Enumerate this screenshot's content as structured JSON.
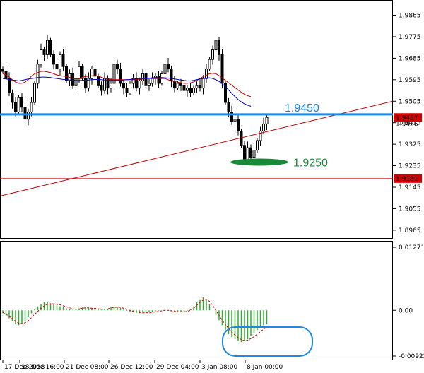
{
  "chart_data": [
    {
      "type": "candlestick",
      "panel": "price",
      "ylim": [
        1.8935,
        1.9905
      ],
      "yticks": [
        "1.9865",
        "1.9775",
        "1.9685",
        "1.9595",
        "1.9505",
        "1.9415",
        "1.9325",
        "1.9235",
        "1.9145",
        "1.9055",
        "1.8965"
      ],
      "xticks": [
        "17 Dec 2018",
        "18 Dec 16:00",
        "21 Dec 08:00",
        "26 Dec 12:00",
        "29 Dec 04:00",
        "3 Jan 08:00",
        "8 Jan 00:00"
      ],
      "current_price_label": "1.9437",
      "current_price_label_partial": "1.9426",
      "ma_fast_color": "#c00000",
      "ma_slow_color": "#0000c8",
      "candle_color": "#000000",
      "candles_close": [
        1.963,
        1.96,
        1.954,
        1.95,
        1.946,
        1.952,
        1.948,
        1.943,
        1.946,
        1.95,
        1.958,
        1.966,
        1.972,
        1.97,
        1.976,
        1.97,
        1.966,
        1.964,
        1.97,
        1.965,
        1.959,
        1.962,
        1.957,
        1.96,
        1.965,
        1.96,
        1.956,
        1.96,
        1.964,
        1.961,
        1.957,
        1.955,
        1.96,
        1.956,
        1.958,
        1.966,
        1.964,
        1.958,
        1.956,
        1.954,
        1.958,
        1.96,
        1.956,
        1.959,
        1.962,
        1.957,
        1.958,
        1.96,
        1.961,
        1.958,
        1.962,
        1.966,
        1.964,
        1.959,
        1.956,
        1.958,
        1.957,
        1.955,
        1.956,
        1.954,
        1.956,
        1.957,
        1.956,
        1.96,
        1.964,
        1.968,
        1.972,
        1.976,
        1.97,
        1.958,
        1.95,
        1.946,
        1.942,
        1.943,
        1.938,
        1.932,
        1.926,
        1.931,
        1.927,
        1.93,
        1.934,
        1.938,
        1.941,
        1.9437
      ],
      "ma_fast": [
        1.962,
        1.9615,
        1.9605,
        1.9595,
        1.9585,
        1.958,
        1.958,
        1.9585,
        1.9595,
        1.961,
        1.962,
        1.9625,
        1.963,
        1.963,
        1.9628,
        1.9625,
        1.962,
        1.9615,
        1.9612,
        1.961,
        1.9608,
        1.9605,
        1.96,
        1.9598,
        1.96,
        1.9605,
        1.9608,
        1.961,
        1.9612,
        1.9612,
        1.961,
        1.9605,
        1.96,
        1.9598,
        1.9595,
        1.9595,
        1.9595,
        1.9595,
        1.9595,
        1.9595,
        1.9595,
        1.9595,
        1.9595,
        1.9595,
        1.9598,
        1.96,
        1.96,
        1.96,
        1.96,
        1.96,
        1.96,
        1.96,
        1.9595,
        1.959,
        1.9588,
        1.9585,
        1.9582,
        1.958,
        1.958,
        1.9582,
        1.9586,
        1.9592,
        1.96,
        1.9608,
        1.9614,
        1.962,
        1.9622,
        1.962,
        1.9612,
        1.9602,
        1.9592,
        1.9582,
        1.9572,
        1.9562,
        1.9552,
        1.9542,
        1.9534,
        1.9528,
        1.9524
      ],
      "ma_slow": [
        1.96,
        1.9598,
        1.9596,
        1.9594,
        1.9592,
        1.959,
        1.9592,
        1.9595,
        1.9598,
        1.96,
        1.9602,
        1.9604,
        1.9606,
        1.9606,
        1.9605,
        1.9604,
        1.9602,
        1.96,
        1.9598,
        1.9596,
        1.9595,
        1.9594,
        1.9593,
        1.9592,
        1.9592,
        1.9592,
        1.9593,
        1.9594,
        1.9595,
        1.9596,
        1.9596,
        1.9595,
        1.9594,
        1.9593,
        1.9592,
        1.9592,
        1.9592,
        1.9593,
        1.9594,
        1.9595,
        1.9596,
        1.9597,
        1.9598,
        1.9599,
        1.96,
        1.9601,
        1.9602,
        1.9603,
        1.9604,
        1.9604,
        1.9604,
        1.9603,
        1.9602,
        1.96,
        1.9598,
        1.9596,
        1.9594,
        1.9592,
        1.959,
        1.959,
        1.9592,
        1.9595,
        1.9598,
        1.96,
        1.9602,
        1.9603,
        1.96,
        1.9595,
        1.9588,
        1.9578,
        1.9566,
        1.9552,
        1.9538,
        1.9524,
        1.9512,
        1.9502,
        1.9494,
        1.9488,
        1.9484
      ],
      "hlines": [
        {
          "value": 1.945,
          "label": "1.9450",
          "color": "#1e88e5"
        },
        {
          "value": 1.9181,
          "label": "1.9181",
          "color": "#d00000"
        }
      ],
      "trendline": {
        "from": [
          0,
          1.9108
        ],
        "to": [
          84,
          1.938
        ],
        "color": "#c00000"
      },
      "support_marker": {
        "value": 1.925,
        "label": "1.9250",
        "color": "#1a8a3a"
      }
    },
    {
      "type": "bar",
      "panel": "oscillator",
      "ylim": [
        -0.00922,
        0.01271
      ],
      "yticks": [
        "0.01271",
        "0.00",
        "-0.00922"
      ],
      "bar_color": "#33aa33",
      "signal_color": "#d00000",
      "values": [
        -0.0006,
        -0.001,
        -0.0016,
        -0.0022,
        -0.0028,
        -0.003,
        -0.0028,
        -0.0022,
        -0.0014,
        -0.0006,
        0.0002,
        0.0008,
        0.0012,
        0.0016,
        0.0016,
        0.0014,
        0.0012,
        0.001,
        0.0008,
        0.0006,
        0.0004,
        0.0002,
        0.0001,
        0.0002,
        0.0004,
        0.0006,
        0.0005,
        0.0004,
        0.0004,
        0.0003,
        0.0002,
        0.0001,
        0.0002,
        0.0003,
        0.0006,
        0.0008,
        0.0007,
        0.0005,
        0.0002,
        -0.0001,
        -0.0003,
        -0.0004,
        -0.0005,
        -0.0006,
        -0.0006,
        -0.0005,
        -0.0004,
        -0.0003,
        -0.0002,
        -0.0001,
        0.0,
        0.0001,
        0.0,
        -0.0002,
        -0.0003,
        -0.0004,
        -0.0003,
        -0.0002,
        -0.0001,
        0.0002,
        0.0008,
        0.0016,
        0.0022,
        0.0026,
        0.0022,
        0.0012,
        0.0,
        -0.001,
        -0.002,
        -0.003,
        -0.004,
        -0.0048,
        -0.0054,
        -0.0058,
        -0.0062,
        -0.0064,
        -0.0062,
        -0.0058,
        -0.0052,
        -0.0046,
        -0.004,
        -0.0034,
        -0.003,
        -0.0028
      ],
      "signal": [
        -0.0004,
        -0.0008,
        -0.0012,
        -0.0017,
        -0.0022,
        -0.0026,
        -0.0027,
        -0.0025,
        -0.0021,
        -0.0015,
        -0.0008,
        -0.0002,
        0.0004,
        0.0009,
        0.0012,
        0.0013,
        0.0013,
        0.0012,
        0.0011,
        0.0009,
        0.0007,
        0.0005,
        0.0003,
        0.0002,
        0.0003,
        0.0004,
        0.0005,
        0.0005,
        0.0004,
        0.0004,
        0.0003,
        0.0002,
        0.0002,
        0.0003,
        0.0004,
        0.0006,
        0.0006,
        0.0006,
        0.0004,
        0.0002,
        0.0,
        -0.0002,
        -0.0003,
        -0.0004,
        -0.0005,
        -0.0005,
        -0.0005,
        -0.0004,
        -0.0003,
        -0.0002,
        -0.0001,
        0.0,
        0.0,
        -0.0001,
        -0.0002,
        -0.0003,
        -0.0003,
        -0.0003,
        -0.0002,
        0.0,
        0.0004,
        0.001,
        0.0016,
        0.0021,
        0.0022,
        0.0018,
        0.001,
        0.0,
        -0.001,
        -0.002,
        -0.0029,
        -0.0037,
        -0.0044,
        -0.005,
        -0.0055,
        -0.0059,
        -0.0061,
        -0.006,
        -0.0057,
        -0.0053,
        -0.0048,
        -0.0043,
        -0.0038,
        -0.0034
      ],
      "highlight_color": "#1e88e5"
    }
  ]
}
